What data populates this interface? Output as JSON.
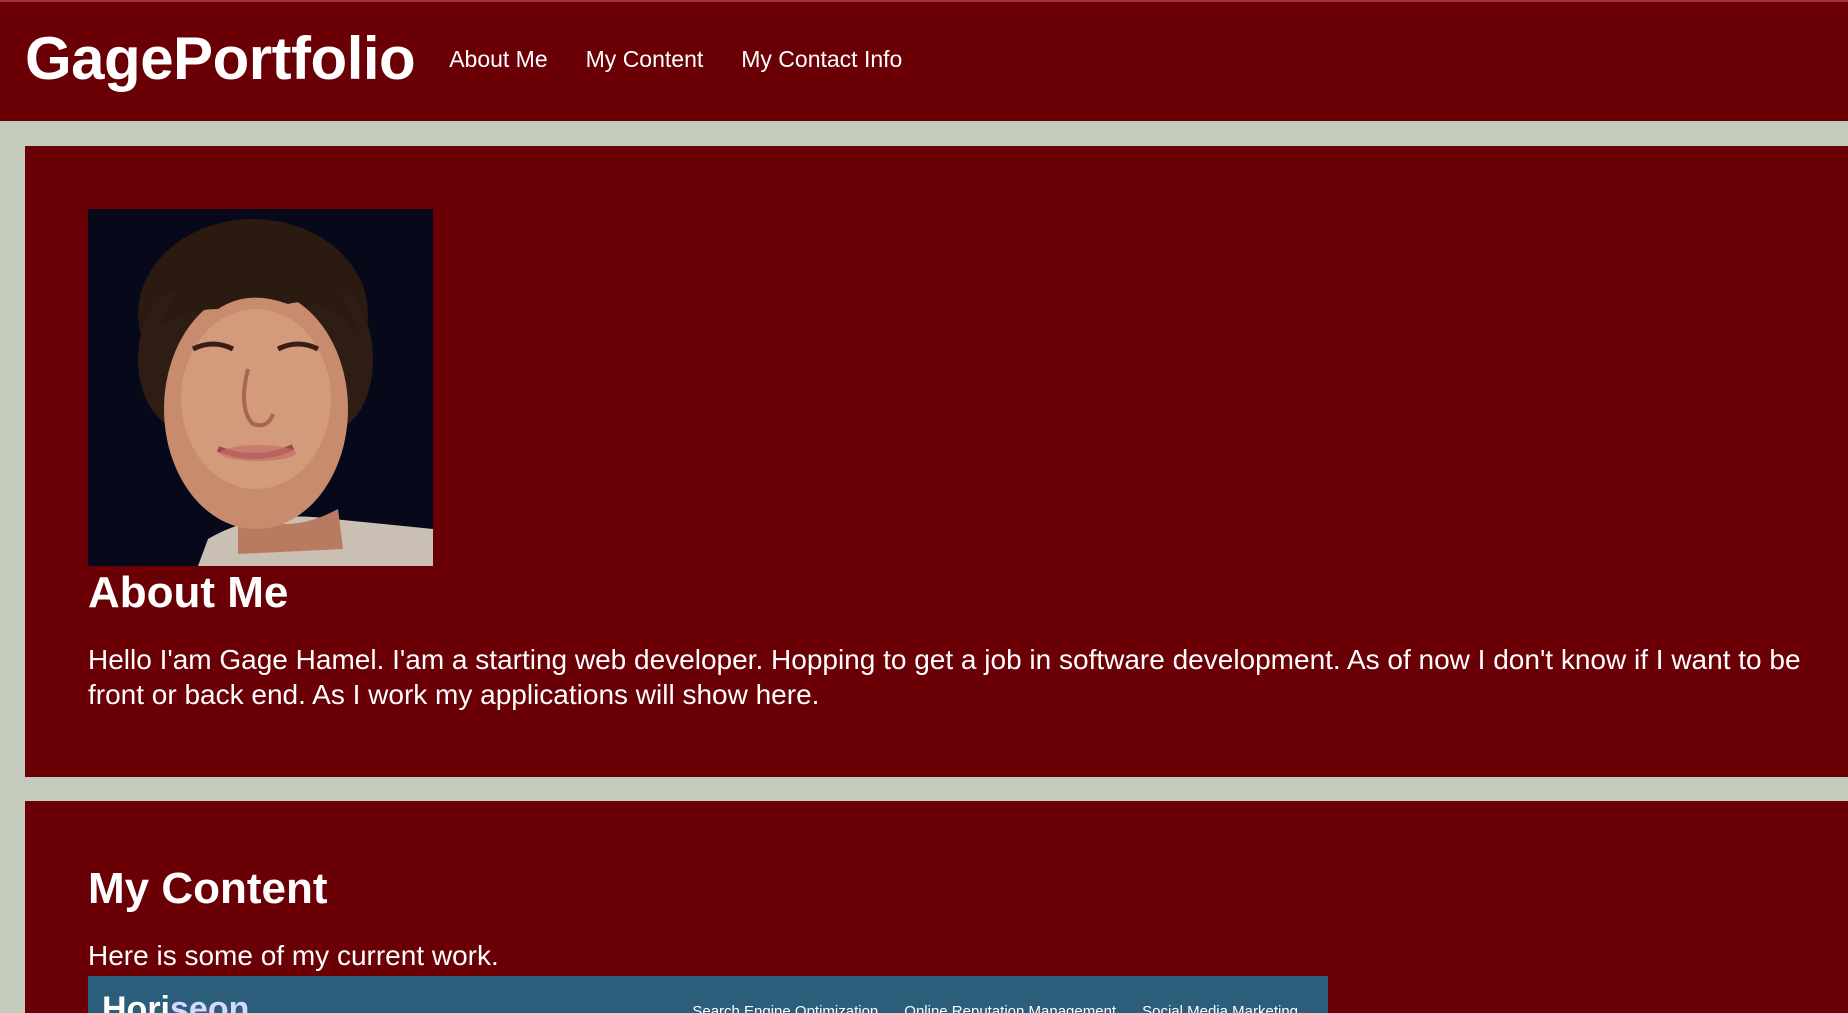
{
  "header": {
    "brand": "GagePortfolio",
    "nav": [
      "About Me",
      "My Content",
      "My Contact Info"
    ]
  },
  "about": {
    "title": "About Me",
    "bio": "Hello I'am Gage Hamel. I'am a starting web developer. Hopping to get a job in software development. As of now I don't know if I want to be front or back end. As I work my applications will show here."
  },
  "content": {
    "title": "My Content",
    "intro": "Here is some of my current work.",
    "preview": {
      "logo_part1": "Hori",
      "logo_part2": "seon",
      "nav": [
        "Search Engine Optimization",
        "Online Reputation Management",
        "Social Media Marketing"
      ]
    }
  },
  "colors": {
    "header_bg": "#6a0006",
    "page_bg": "#c4cbbd",
    "card_bg": "#6a0006",
    "preview_bg": "#2a5e7a"
  }
}
